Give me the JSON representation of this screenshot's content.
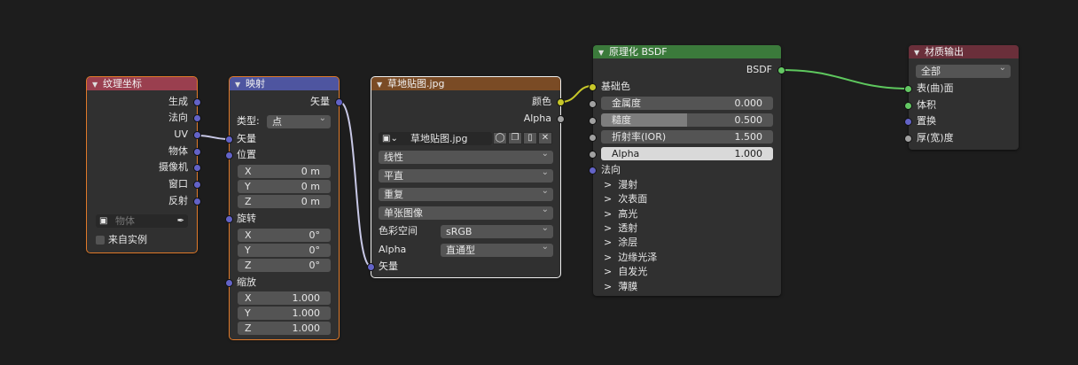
{
  "colors": {
    "tex_coord_header": "#9a3f4f",
    "mapping_header": "#4e55a0",
    "image_header": "#7a4b25",
    "bsdf_header": "#3b7a3b",
    "output_header": "#6a2f3a",
    "wire": "#c8c8e6",
    "wire_color": "#c7c729",
    "wire_shader": "#5ec85e"
  },
  "tex_coord": {
    "title": "纹理坐标",
    "outputs": [
      "生成",
      "法向",
      "UV",
      "物体",
      "摄像机",
      "窗口",
      "反射"
    ],
    "object_placeholder": "物体",
    "from_instancer": "来自实例"
  },
  "mapping": {
    "title": "映射",
    "output": "矢量",
    "type_label": "类型:",
    "type_value": "点",
    "vector_input": "矢量",
    "location_label": "位置",
    "location": [
      {
        "axis": "X",
        "value": "0 m"
      },
      {
        "axis": "Y",
        "value": "0 m"
      },
      {
        "axis": "Z",
        "value": "0 m"
      }
    ],
    "rotation_label": "旋转",
    "rotation": [
      {
        "axis": "X",
        "value": "0°"
      },
      {
        "axis": "Y",
        "value": "0°"
      },
      {
        "axis": "Z",
        "value": "0°"
      }
    ],
    "scale_label": "缩放",
    "scale": [
      {
        "axis": "X",
        "value": "1.000"
      },
      {
        "axis": "Y",
        "value": "1.000"
      },
      {
        "axis": "Z",
        "value": "1.000"
      }
    ]
  },
  "image_texture": {
    "title": "草地贴图.jpg",
    "outputs": [
      "颜色",
      "Alpha"
    ],
    "image_name": "草地贴图.jpg",
    "interpolation": "线性",
    "projection": "平直",
    "extension": "重复",
    "source": "单张图像",
    "color_space_label": "色彩空间",
    "color_space_value": "sRGB",
    "alpha_label": "Alpha",
    "alpha_value": "直通型",
    "vector_input": "矢量"
  },
  "bsdf": {
    "title": "原理化 BSDF",
    "output": "BSDF",
    "base_color": "基础色",
    "fields": [
      {
        "label": "金属度",
        "value": "0.000",
        "fill": 0.0
      },
      {
        "label": "糙度",
        "value": "0.500",
        "fill": 0.5
      },
      {
        "label": "折射率(IOR)",
        "value": "1.500",
        "fill": 0.0
      },
      {
        "label": "Alpha",
        "value": "1.000",
        "fill": 1.0
      }
    ],
    "normal": "法向",
    "panels": [
      "漫射",
      "次表面",
      "高光",
      "透射",
      "涂层",
      "边缘光泽",
      "自发光",
      "薄膜"
    ]
  },
  "output": {
    "title": "材质输出",
    "target": "全部",
    "inputs": [
      "表(曲)面",
      "体积",
      "置换",
      "厚(宽)度"
    ]
  }
}
